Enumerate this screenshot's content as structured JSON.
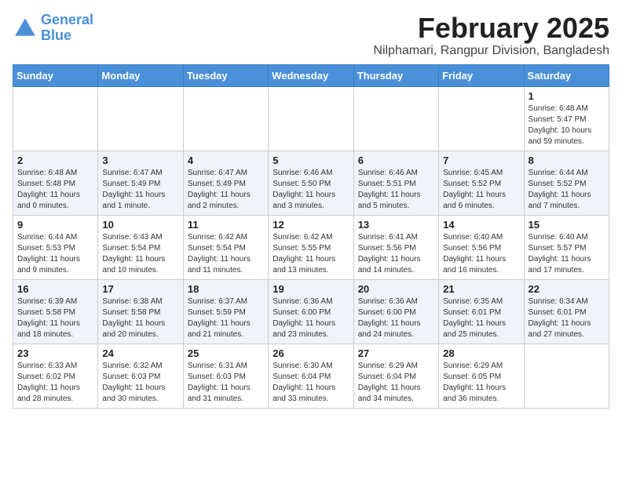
{
  "header": {
    "logo_line1": "General",
    "logo_line2": "Blue",
    "month_year": "February 2025",
    "location": "Nilphamari, Rangpur Division, Bangladesh"
  },
  "weekdays": [
    "Sunday",
    "Monday",
    "Tuesday",
    "Wednesday",
    "Thursday",
    "Friday",
    "Saturday"
  ],
  "weeks": [
    [
      {
        "day": "",
        "info": ""
      },
      {
        "day": "",
        "info": ""
      },
      {
        "day": "",
        "info": ""
      },
      {
        "day": "",
        "info": ""
      },
      {
        "day": "",
        "info": ""
      },
      {
        "day": "",
        "info": ""
      },
      {
        "day": "1",
        "info": "Sunrise: 6:48 AM\nSunset: 5:47 PM\nDaylight: 10 hours\nand 59 minutes."
      }
    ],
    [
      {
        "day": "2",
        "info": "Sunrise: 6:48 AM\nSunset: 5:48 PM\nDaylight: 11 hours\nand 0 minutes."
      },
      {
        "day": "3",
        "info": "Sunrise: 6:47 AM\nSunset: 5:49 PM\nDaylight: 11 hours\nand 1 minute."
      },
      {
        "day": "4",
        "info": "Sunrise: 6:47 AM\nSunset: 5:49 PM\nDaylight: 11 hours\nand 2 minutes."
      },
      {
        "day": "5",
        "info": "Sunrise: 6:46 AM\nSunset: 5:50 PM\nDaylight: 11 hours\nand 3 minutes."
      },
      {
        "day": "6",
        "info": "Sunrise: 6:46 AM\nSunset: 5:51 PM\nDaylight: 11 hours\nand 5 minutes."
      },
      {
        "day": "7",
        "info": "Sunrise: 6:45 AM\nSunset: 5:52 PM\nDaylight: 11 hours\nand 6 minutes."
      },
      {
        "day": "8",
        "info": "Sunrise: 6:44 AM\nSunset: 5:52 PM\nDaylight: 11 hours\nand 7 minutes."
      }
    ],
    [
      {
        "day": "9",
        "info": "Sunrise: 6:44 AM\nSunset: 5:53 PM\nDaylight: 11 hours\nand 9 minutes."
      },
      {
        "day": "10",
        "info": "Sunrise: 6:43 AM\nSunset: 5:54 PM\nDaylight: 11 hours\nand 10 minutes."
      },
      {
        "day": "11",
        "info": "Sunrise: 6:42 AM\nSunset: 5:54 PM\nDaylight: 11 hours\nand 11 minutes."
      },
      {
        "day": "12",
        "info": "Sunrise: 6:42 AM\nSunset: 5:55 PM\nDaylight: 11 hours\nand 13 minutes."
      },
      {
        "day": "13",
        "info": "Sunrise: 6:41 AM\nSunset: 5:56 PM\nDaylight: 11 hours\nand 14 minutes."
      },
      {
        "day": "14",
        "info": "Sunrise: 6:40 AM\nSunset: 5:56 PM\nDaylight: 11 hours\nand 16 minutes."
      },
      {
        "day": "15",
        "info": "Sunrise: 6:40 AM\nSunset: 5:57 PM\nDaylight: 11 hours\nand 17 minutes."
      }
    ],
    [
      {
        "day": "16",
        "info": "Sunrise: 6:39 AM\nSunset: 5:58 PM\nDaylight: 11 hours\nand 18 minutes."
      },
      {
        "day": "17",
        "info": "Sunrise: 6:38 AM\nSunset: 5:58 PM\nDaylight: 11 hours\nand 20 minutes."
      },
      {
        "day": "18",
        "info": "Sunrise: 6:37 AM\nSunset: 5:59 PM\nDaylight: 11 hours\nand 21 minutes."
      },
      {
        "day": "19",
        "info": "Sunrise: 6:36 AM\nSunset: 6:00 PM\nDaylight: 11 hours\nand 23 minutes."
      },
      {
        "day": "20",
        "info": "Sunrise: 6:36 AM\nSunset: 6:00 PM\nDaylight: 11 hours\nand 24 minutes."
      },
      {
        "day": "21",
        "info": "Sunrise: 6:35 AM\nSunset: 6:01 PM\nDaylight: 11 hours\nand 25 minutes."
      },
      {
        "day": "22",
        "info": "Sunrise: 6:34 AM\nSunset: 6:01 PM\nDaylight: 11 hours\nand 27 minutes."
      }
    ],
    [
      {
        "day": "23",
        "info": "Sunrise: 6:33 AM\nSunset: 6:02 PM\nDaylight: 11 hours\nand 28 minutes."
      },
      {
        "day": "24",
        "info": "Sunrise: 6:32 AM\nSunset: 6:03 PM\nDaylight: 11 hours\nand 30 minutes."
      },
      {
        "day": "25",
        "info": "Sunrise: 6:31 AM\nSunset: 6:03 PM\nDaylight: 11 hours\nand 31 minutes."
      },
      {
        "day": "26",
        "info": "Sunrise: 6:30 AM\nSunset: 6:04 PM\nDaylight: 11 hours\nand 33 minutes."
      },
      {
        "day": "27",
        "info": "Sunrise: 6:29 AM\nSunset: 6:04 PM\nDaylight: 11 hours\nand 34 minutes."
      },
      {
        "day": "28",
        "info": "Sunrise: 6:29 AM\nSunset: 6:05 PM\nDaylight: 11 hours\nand 36 minutes."
      },
      {
        "day": "",
        "info": ""
      }
    ]
  ]
}
